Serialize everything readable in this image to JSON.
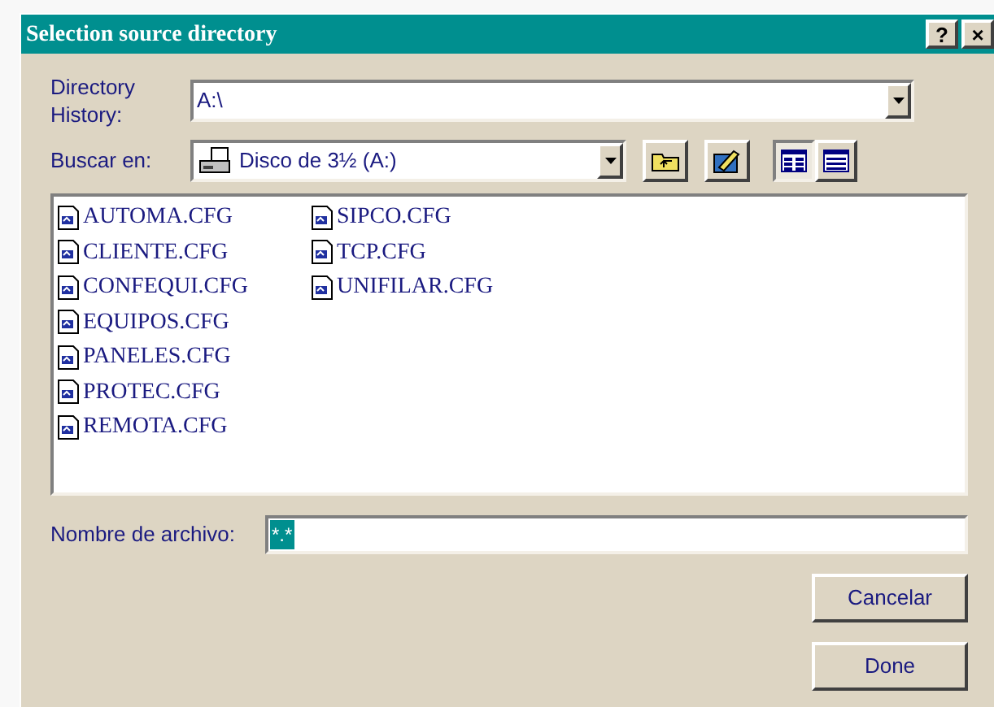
{
  "window": {
    "title": "Selection source directory",
    "title_buttons": [
      "?",
      "×"
    ]
  },
  "directory_history": {
    "label": "Directory History:",
    "value": "A:\\"
  },
  "look_in": {
    "label": "Buscar en:",
    "value": "Disco de 3½ (A:)"
  },
  "view_buttons": [
    {
      "kind": "list",
      "selected": true
    },
    {
      "kind": "details",
      "selected": false
    }
  ],
  "files": [
    {
      "name": "AUTOMA.CFG"
    },
    {
      "name": "CLIENTE.CFG"
    },
    {
      "name": "CONFEQUI.CFG"
    },
    {
      "name": "EQUIPOS.CFG"
    },
    {
      "name": "PANELES.CFG"
    },
    {
      "name": "PROTEC.CFG"
    },
    {
      "name": "REMOTA.CFG"
    },
    {
      "name": "SIPCO.CFG"
    },
    {
      "name": "TCP.CFG"
    },
    {
      "name": "UNIFILAR.CFG"
    }
  ],
  "file_name": {
    "label": "Nombre de archivo:",
    "value": "*.*",
    "selected": true
  },
  "buttons": [
    "Cancelar",
    "Done"
  ]
}
